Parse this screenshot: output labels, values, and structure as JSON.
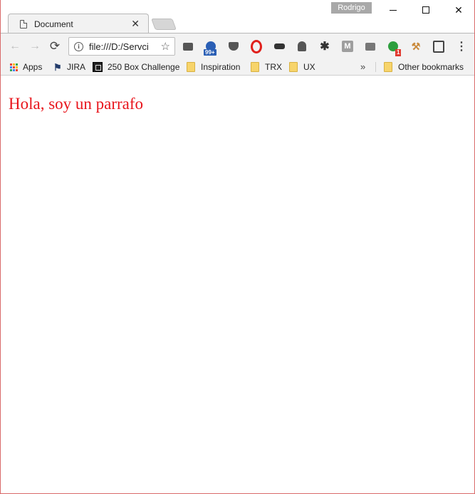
{
  "window": {
    "profile_name": "Rodrigo",
    "minimize_glyph": "",
    "close_glyph": "✕"
  },
  "tabs": [
    {
      "title": "Document",
      "close_glyph": "✕"
    }
  ],
  "toolbar": {
    "back_glyph": "←",
    "forward_glyph": "→",
    "reload_glyph": "⟳",
    "url": "file:///D:/Servci",
    "info_glyph": "i",
    "star_glyph": "☆",
    "extensions": [
      {
        "icon": "mail-icon"
      },
      {
        "icon": "notification-icon",
        "badge": "99+"
      },
      {
        "icon": "pocket-icon"
      },
      {
        "icon": "opera-icon"
      },
      {
        "icon": "mask-icon"
      },
      {
        "icon": "ghostery-icon"
      },
      {
        "icon": "gear-icon",
        "glyph": "✱"
      },
      {
        "icon": "m-icon",
        "glyph": "M"
      },
      {
        "icon": "camera-icon"
      },
      {
        "icon": "green-extension-icon",
        "badge": "1"
      },
      {
        "icon": "hammer-icon",
        "glyph": "⚒"
      },
      {
        "icon": "lightbulb-icon"
      },
      {
        "icon": "menu-icon",
        "glyph": "⋮"
      }
    ]
  },
  "bookmarks": {
    "items": [
      {
        "label": "Apps",
        "icon": "apps-icon"
      },
      {
        "label": "JIRA",
        "icon": "jira-icon"
      },
      {
        "label": "250 Box Challenge",
        "icon": "box-icon"
      },
      {
        "label": "Inspiration",
        "icon": "folder-icon"
      },
      {
        "label": "TRX",
        "icon": "folder-icon"
      },
      {
        "label": "UX",
        "icon": "folder-icon"
      }
    ],
    "overflow_glyph": "»",
    "other": {
      "label": "Other bookmarks",
      "icon": "folder-icon"
    }
  },
  "page": {
    "paragraph": "Hola, soy un parrafo",
    "paragraph_color": "#e8141b"
  },
  "colors": {
    "apps_grid": [
      "#ea4335",
      "#fbbc05",
      "#34a853",
      "#4285f4",
      "#ea4335",
      "#fbbc05",
      "#34a853",
      "#4285f4",
      "#ea4335"
    ]
  }
}
